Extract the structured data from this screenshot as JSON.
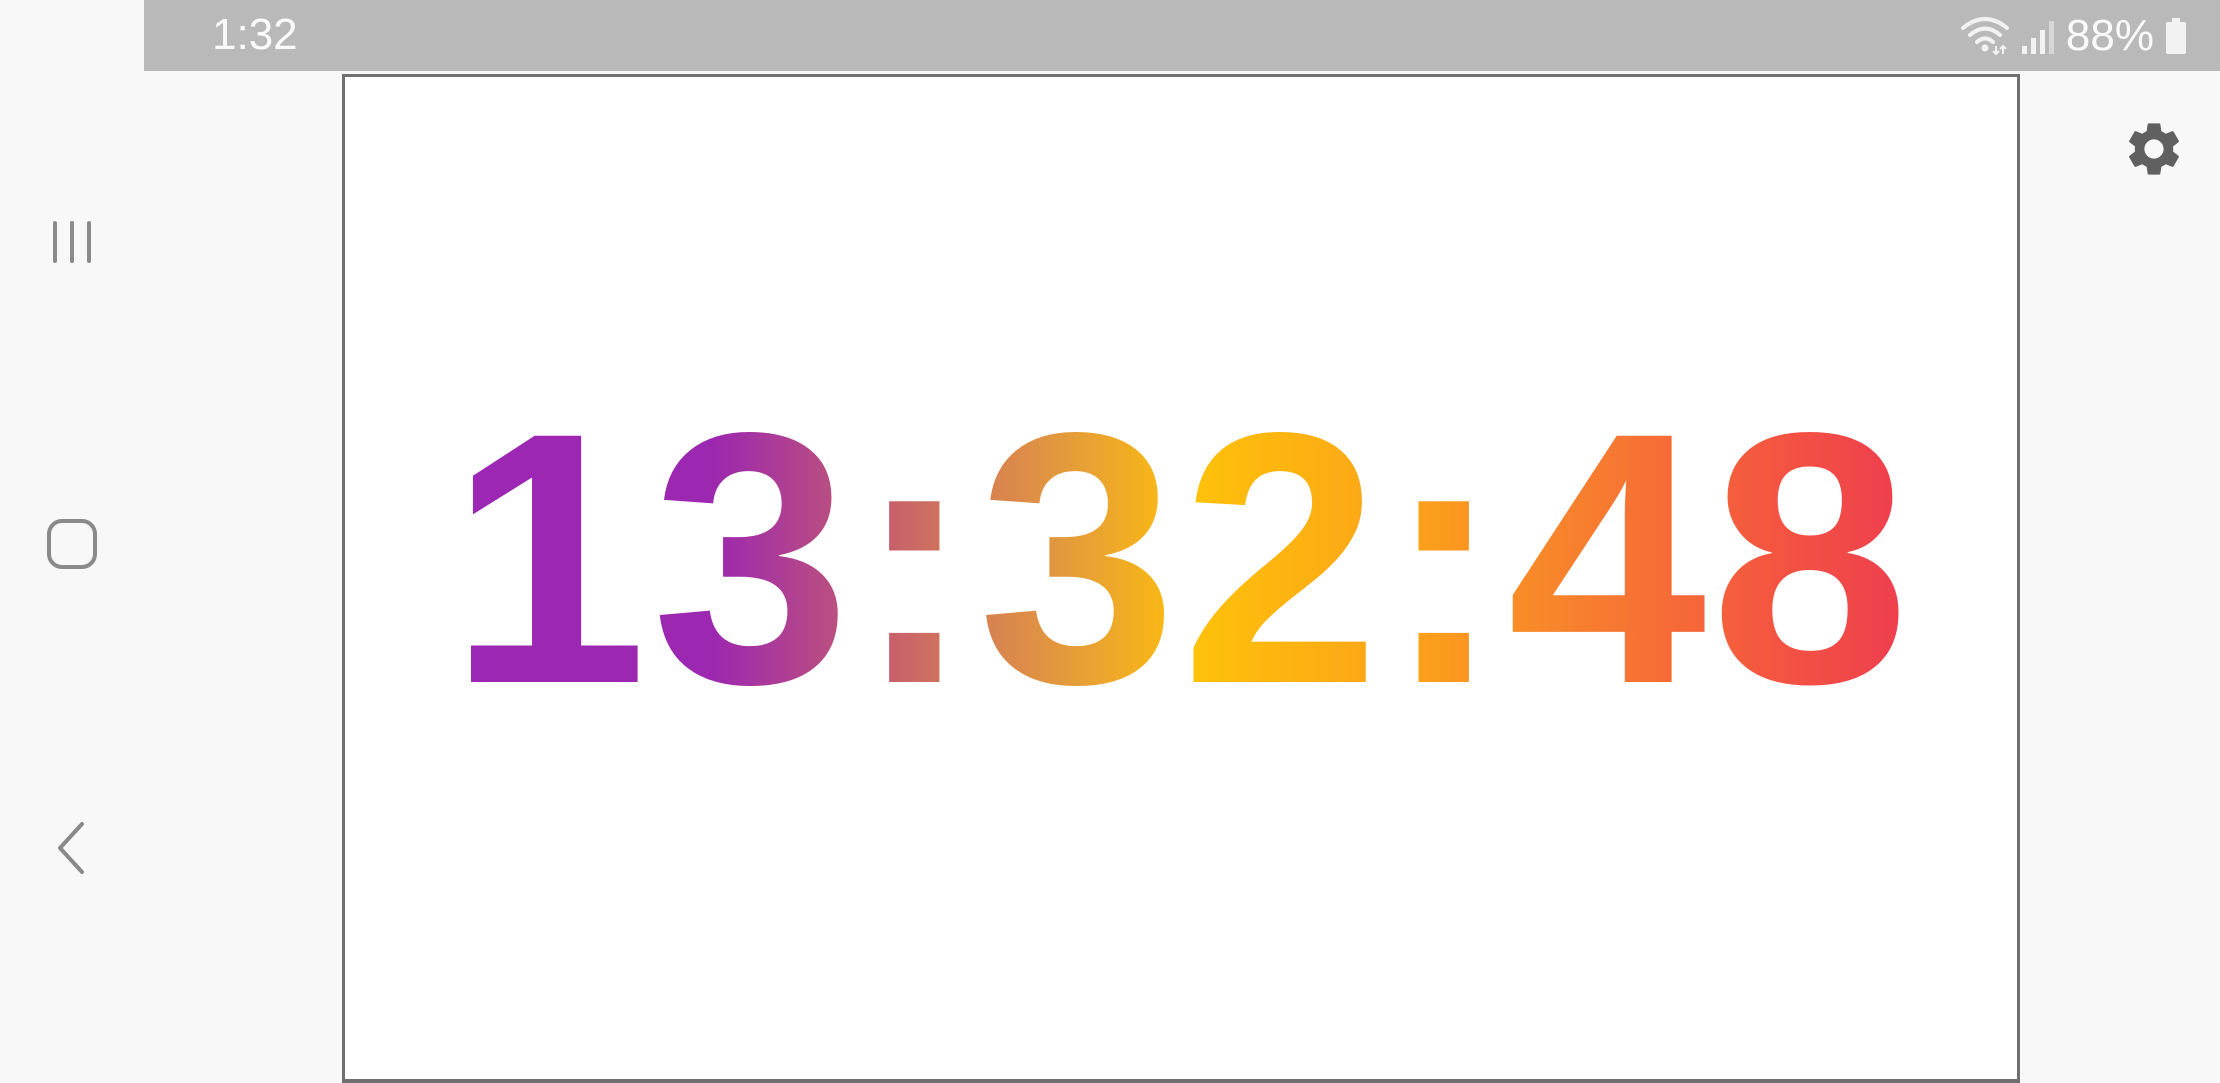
{
  "status_bar": {
    "time": "1:32",
    "battery_percent": "88%",
    "icons": [
      "wifi-icon",
      "signal-icon",
      "battery-icon"
    ]
  },
  "navigation": {
    "buttons": [
      "recents-icon",
      "home-icon",
      "back-icon"
    ]
  },
  "clock": {
    "time": "13:32:48",
    "gradient_colors": [
      "#9c27b0",
      "#ffc107",
      "#ee3c50"
    ]
  },
  "settings": {
    "icon": "gear-icon",
    "color": "#606060"
  },
  "colors": {
    "status_bar_bg": "#b9b9b9",
    "frame_border": "#707070",
    "background": "#f8f8f8"
  }
}
